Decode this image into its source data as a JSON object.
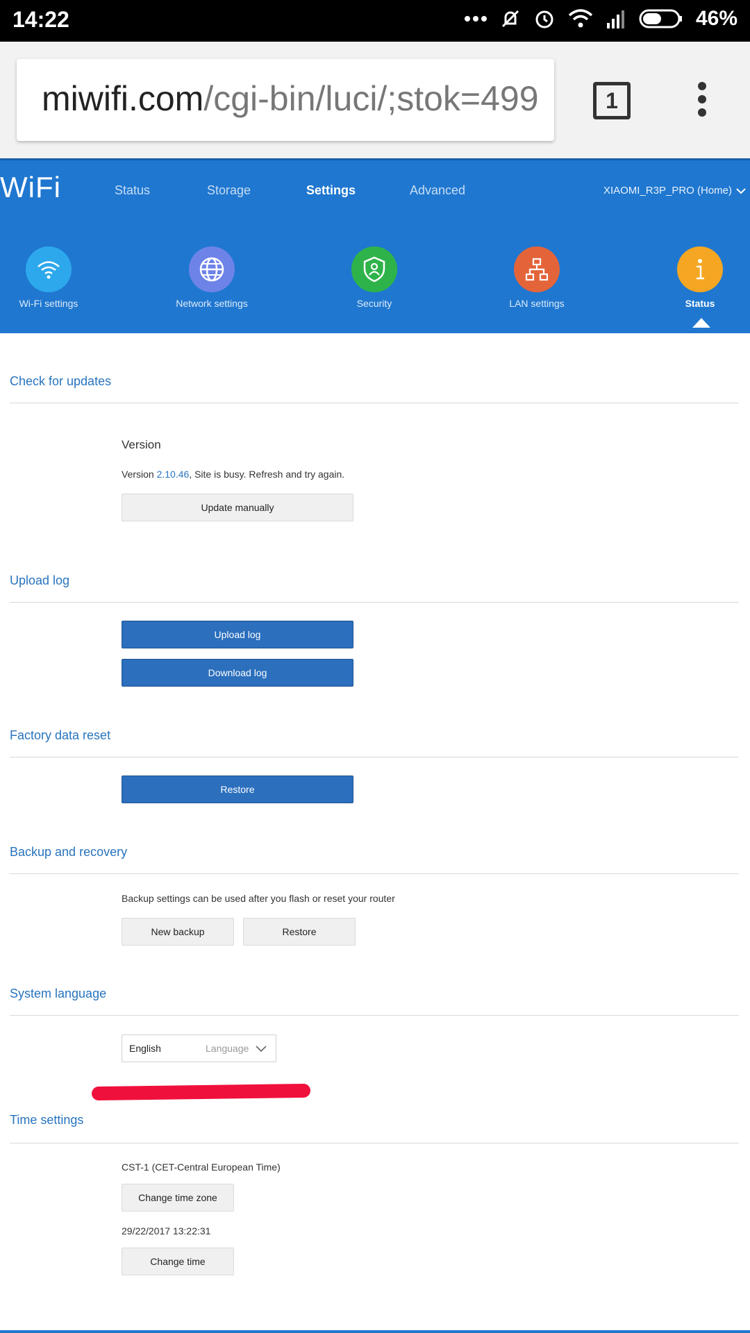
{
  "statusbar": {
    "time": "14:22",
    "battery": "46%"
  },
  "browser": {
    "url_host": "miwifi.com",
    "url_path": "/cgi-bin/luci/;stok=499",
    "tab_count": "1"
  },
  "header": {
    "logo": "WiFi",
    "nav": [
      "Status",
      "Storage",
      "Settings",
      "Advanced"
    ],
    "active_nav": "Settings",
    "device": "XIAOMI_R3P_PRO (Home)"
  },
  "categories": [
    {
      "label": "Wi-Fi settings",
      "icon": "wifi-icon",
      "color": "#2ea8ec"
    },
    {
      "label": "Network settings",
      "icon": "globe-icon",
      "color": "#6e83e8"
    },
    {
      "label": "Security",
      "icon": "shield-icon",
      "color": "#2eb34a"
    },
    {
      "label": "LAN settings",
      "icon": "lan-icon",
      "color": "#e4643a"
    },
    {
      "label": "Status",
      "icon": "info-icon",
      "color": "#f5a623"
    }
  ],
  "updates": {
    "title": "Check for updates",
    "version_heading": "Version",
    "version_prefix": "Version ",
    "version_number": "2.10.46",
    "version_suffix": ", Site is busy. Refresh and try again.",
    "update_button": "Update manually"
  },
  "upload_log": {
    "title": "Upload log",
    "upload_button": "Upload log",
    "download_button": "Download log"
  },
  "factory_reset": {
    "title": "Factory data reset",
    "restore_button": "Restore"
  },
  "backup": {
    "title": "Backup and recovery",
    "description": "Backup settings can be used after you flash or reset your router",
    "new_backup_button": "New backup",
    "restore_button": "Restore"
  },
  "language": {
    "title": "System language",
    "value": "English",
    "placeholder": "Language"
  },
  "time": {
    "title": "Time settings",
    "timezone": "CST-1 (CET-Central European Time)",
    "change_timezone_button": "Change time zone",
    "datetime": "29/22/2017 13:22:31",
    "change_time_button": "Change time"
  },
  "colors": {
    "accent": "#1f77d0",
    "link": "#2874be",
    "button_blue": "#2b6fbd",
    "highlight_mark": "#f0103c"
  }
}
